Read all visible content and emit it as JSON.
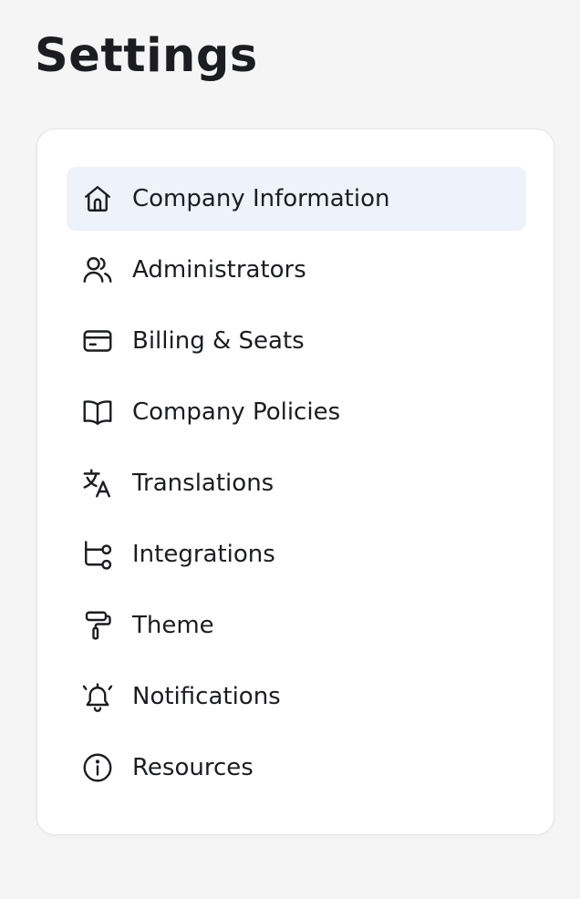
{
  "page": {
    "title": "Settings"
  },
  "menu": {
    "active_index": 0,
    "items": [
      {
        "label": "Company Information",
        "icon": "home-icon"
      },
      {
        "label": "Administrators",
        "icon": "users-icon"
      },
      {
        "label": "Billing & Seats",
        "icon": "credit-card-icon"
      },
      {
        "label": "Company Policies",
        "icon": "book-open-icon"
      },
      {
        "label": "Translations",
        "icon": "language-icon"
      },
      {
        "label": "Integrations",
        "icon": "route-icon"
      },
      {
        "label": "Theme",
        "icon": "paint-roller-icon"
      },
      {
        "label": "Notifications",
        "icon": "bell-ringing-icon"
      },
      {
        "label": "Resources",
        "icon": "info-circle-icon"
      }
    ]
  },
  "colors": {
    "active_background": "#edf2fb",
    "text": "#1c1d21",
    "page_background": "#f5f5f6",
    "card_background": "#ffffff"
  }
}
